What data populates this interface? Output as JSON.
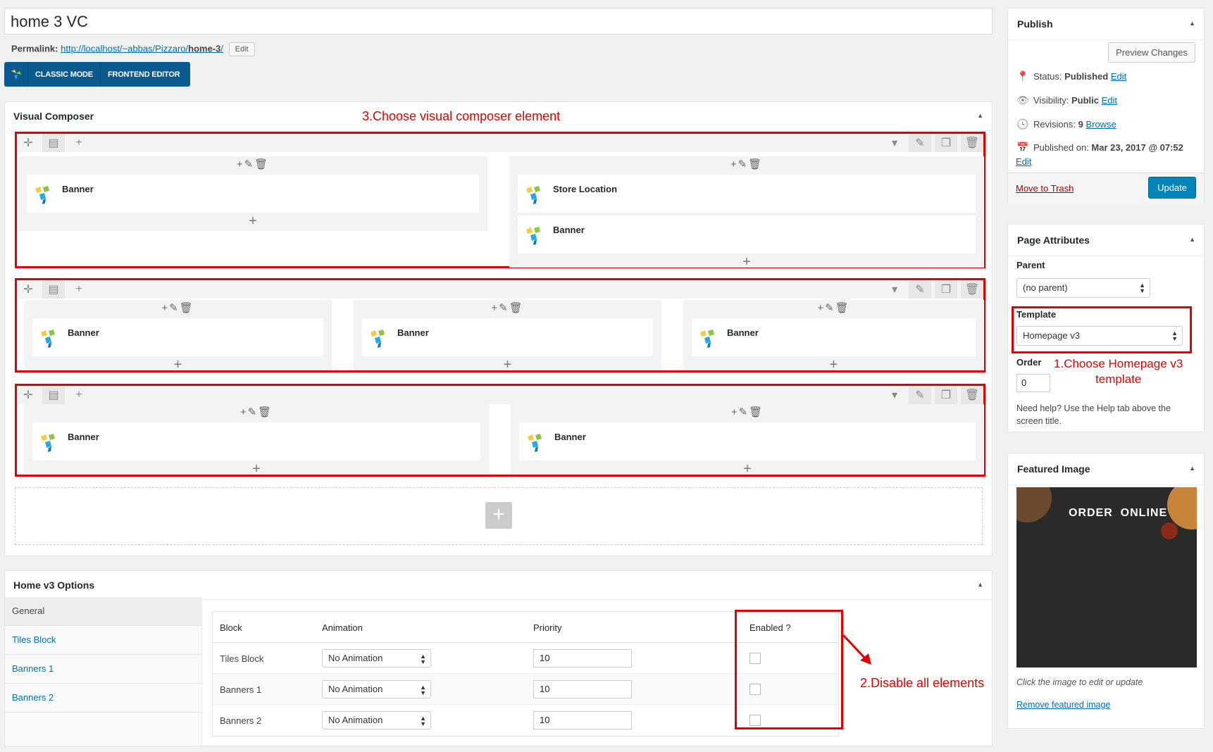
{
  "post_title": "home 3 VC",
  "permalink": {
    "label": "Permalink:",
    "url_prefix": "http://localhost/~abbas/Pizzaro/",
    "slug": "home-3",
    "url_suffix": "/",
    "edit_label": "Edit"
  },
  "vc_switch": {
    "classic_label": "CLASSIC MODE",
    "frontend_label": "FRONTEND EDITOR"
  },
  "visual_composer": {
    "title": "Visual Composer",
    "rows": [
      {
        "columns": [
          {
            "elements": [
              "Banner"
            ]
          },
          {
            "elements": [
              "Store Location",
              "Banner"
            ]
          }
        ]
      },
      {
        "columns": [
          {
            "elements": [
              "Banner"
            ]
          },
          {
            "elements": [
              "Banner"
            ]
          },
          {
            "elements": [
              "Banner"
            ]
          }
        ]
      },
      {
        "columns": [
          {
            "elements": [
              "Banner"
            ]
          },
          {
            "elements": [
              "Banner"
            ]
          }
        ]
      }
    ]
  },
  "annotations": {
    "choose_vc": "3.Choose visual composer element",
    "choose_template_1": "1.Choose Homepage v3",
    "choose_template_2": "template",
    "disable": "2.Disable all elements"
  },
  "home_options": {
    "title": "Home v3 Options",
    "tabs": [
      "General",
      "Tiles Block",
      "Banners 1",
      "Banners 2"
    ],
    "headers": {
      "block": "Block",
      "animation": "Animation",
      "priority": "Priority",
      "enabled": "Enabled ?"
    },
    "rows": [
      {
        "block": "Tiles Block",
        "animation": "No Animation",
        "priority": "10",
        "enabled": false
      },
      {
        "block": "Banners 1",
        "animation": "No Animation",
        "priority": "10",
        "enabled": false
      },
      {
        "block": "Banners 2",
        "animation": "No Animation",
        "priority": "10",
        "enabled": false
      }
    ]
  },
  "publish": {
    "title": "Publish",
    "preview_label": "Preview Changes",
    "status_label": "Status:",
    "status_value": "Published",
    "visibility_label": "Visibility:",
    "visibility_value": "Public",
    "revisions_label": "Revisions:",
    "revisions_value": "9",
    "browse_label": "Browse",
    "published_label": "Published on:",
    "published_value": "Mar 23, 2017 @ 07:52",
    "edit_label": "Edit",
    "trash_label": "Move to Trash",
    "update_label": "Update"
  },
  "page_attributes": {
    "title": "Page Attributes",
    "parent_label": "Parent",
    "parent_value": "(no parent)",
    "template_label": "Template",
    "template_value": "Homepage v3",
    "order_label": "Order",
    "order_value": "0",
    "help_text": "Need help? Use the Help tab above the screen title."
  },
  "featured_image": {
    "title": "Featured Image",
    "image_text_left": "ORDER",
    "image_text_right": "ONLINE",
    "caption": "Click the image to edit or update",
    "remove_label": "Remove featured image"
  },
  "colors": {
    "annotation": "#e30000",
    "wp_blue": "#0073aa",
    "vc_blue": "#0b5a8f"
  }
}
